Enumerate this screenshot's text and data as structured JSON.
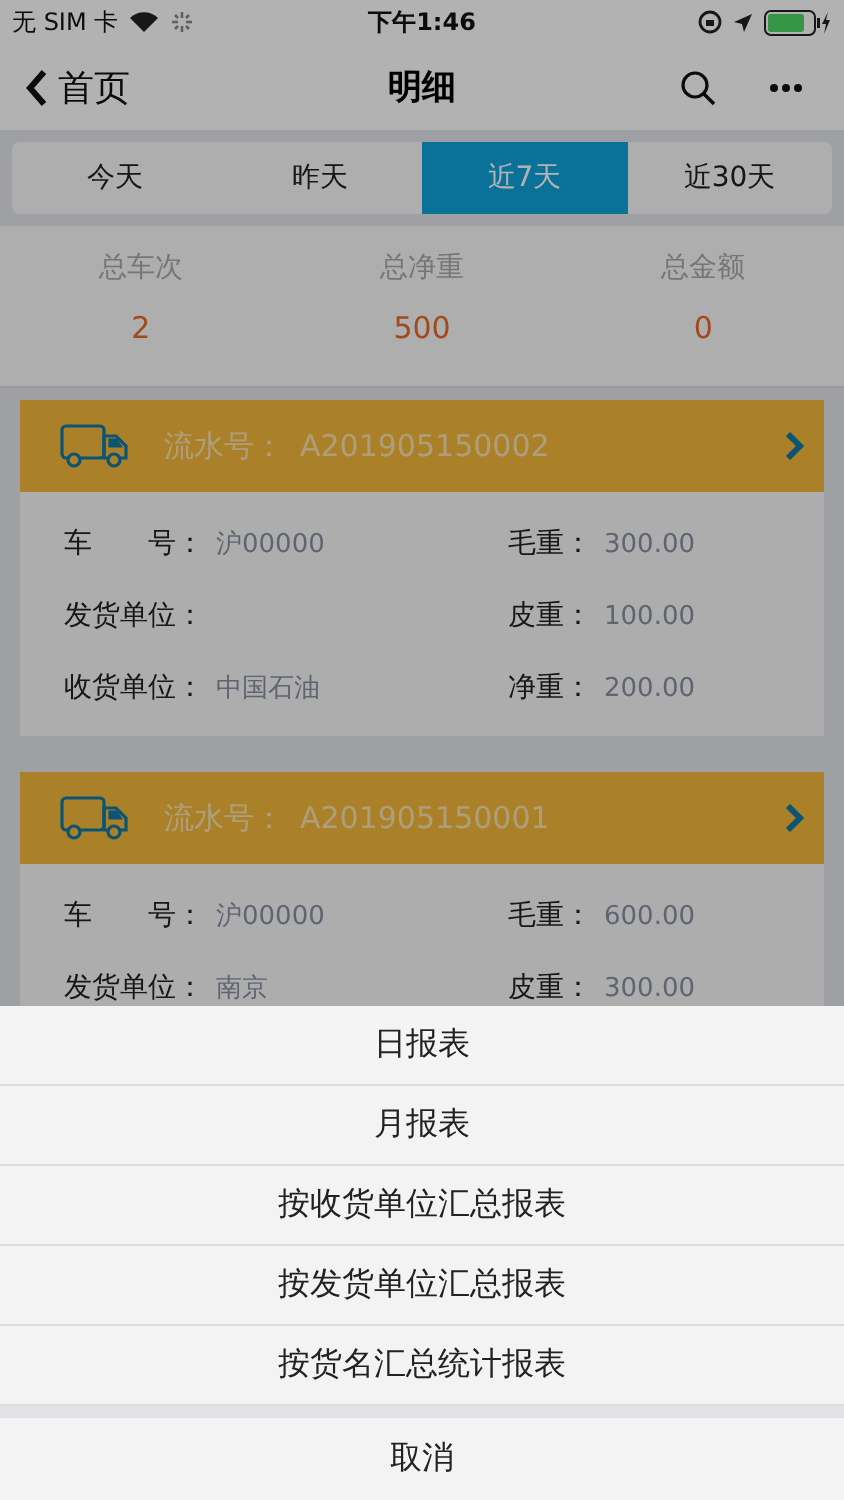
{
  "status_bar": {
    "carrier": "无 SIM 卡",
    "time": "下午1:46"
  },
  "nav": {
    "back": "首页",
    "title": "明细"
  },
  "tabs": [
    {
      "label": "今天",
      "selected": false
    },
    {
      "label": "昨天",
      "selected": false
    },
    {
      "label": "近7天",
      "selected": true
    },
    {
      "label": "近30天",
      "selected": false
    }
  ],
  "summary": [
    {
      "label": "总车次",
      "value": "2"
    },
    {
      "label": "总净重",
      "value": "500"
    },
    {
      "label": "总金额",
      "value": "0"
    }
  ],
  "records": [
    {
      "serial_label": "流水号：",
      "serial": "A201905150002",
      "fields": [
        {
          "label": "车　　号：",
          "value": "沪00000"
        },
        {
          "label": "毛重：",
          "value": "300.00"
        },
        {
          "label": "发货单位："
        },
        {
          "label": "皮重：",
          "value": "100.00"
        },
        {
          "label": "收货单位：",
          "value": "中国石油"
        },
        {
          "label": "净重：",
          "value": "200.00"
        }
      ]
    },
    {
      "serial_label": "流水号：",
      "serial": "A201905150001",
      "fields": [
        {
          "label": "车　　号：",
          "value": "沪00000"
        },
        {
          "label": "毛重：",
          "value": "600.00"
        },
        {
          "label": "发货单位：",
          "value": "南京"
        },
        {
          "label": "皮重：",
          "value": "300.00"
        }
      ]
    }
  ],
  "action_sheet": {
    "options": [
      "日报表",
      "月报表",
      "按收货单位汇总报表",
      "按发货单位汇总报表",
      "按货名汇总统计报表"
    ],
    "cancel": "取消"
  }
}
